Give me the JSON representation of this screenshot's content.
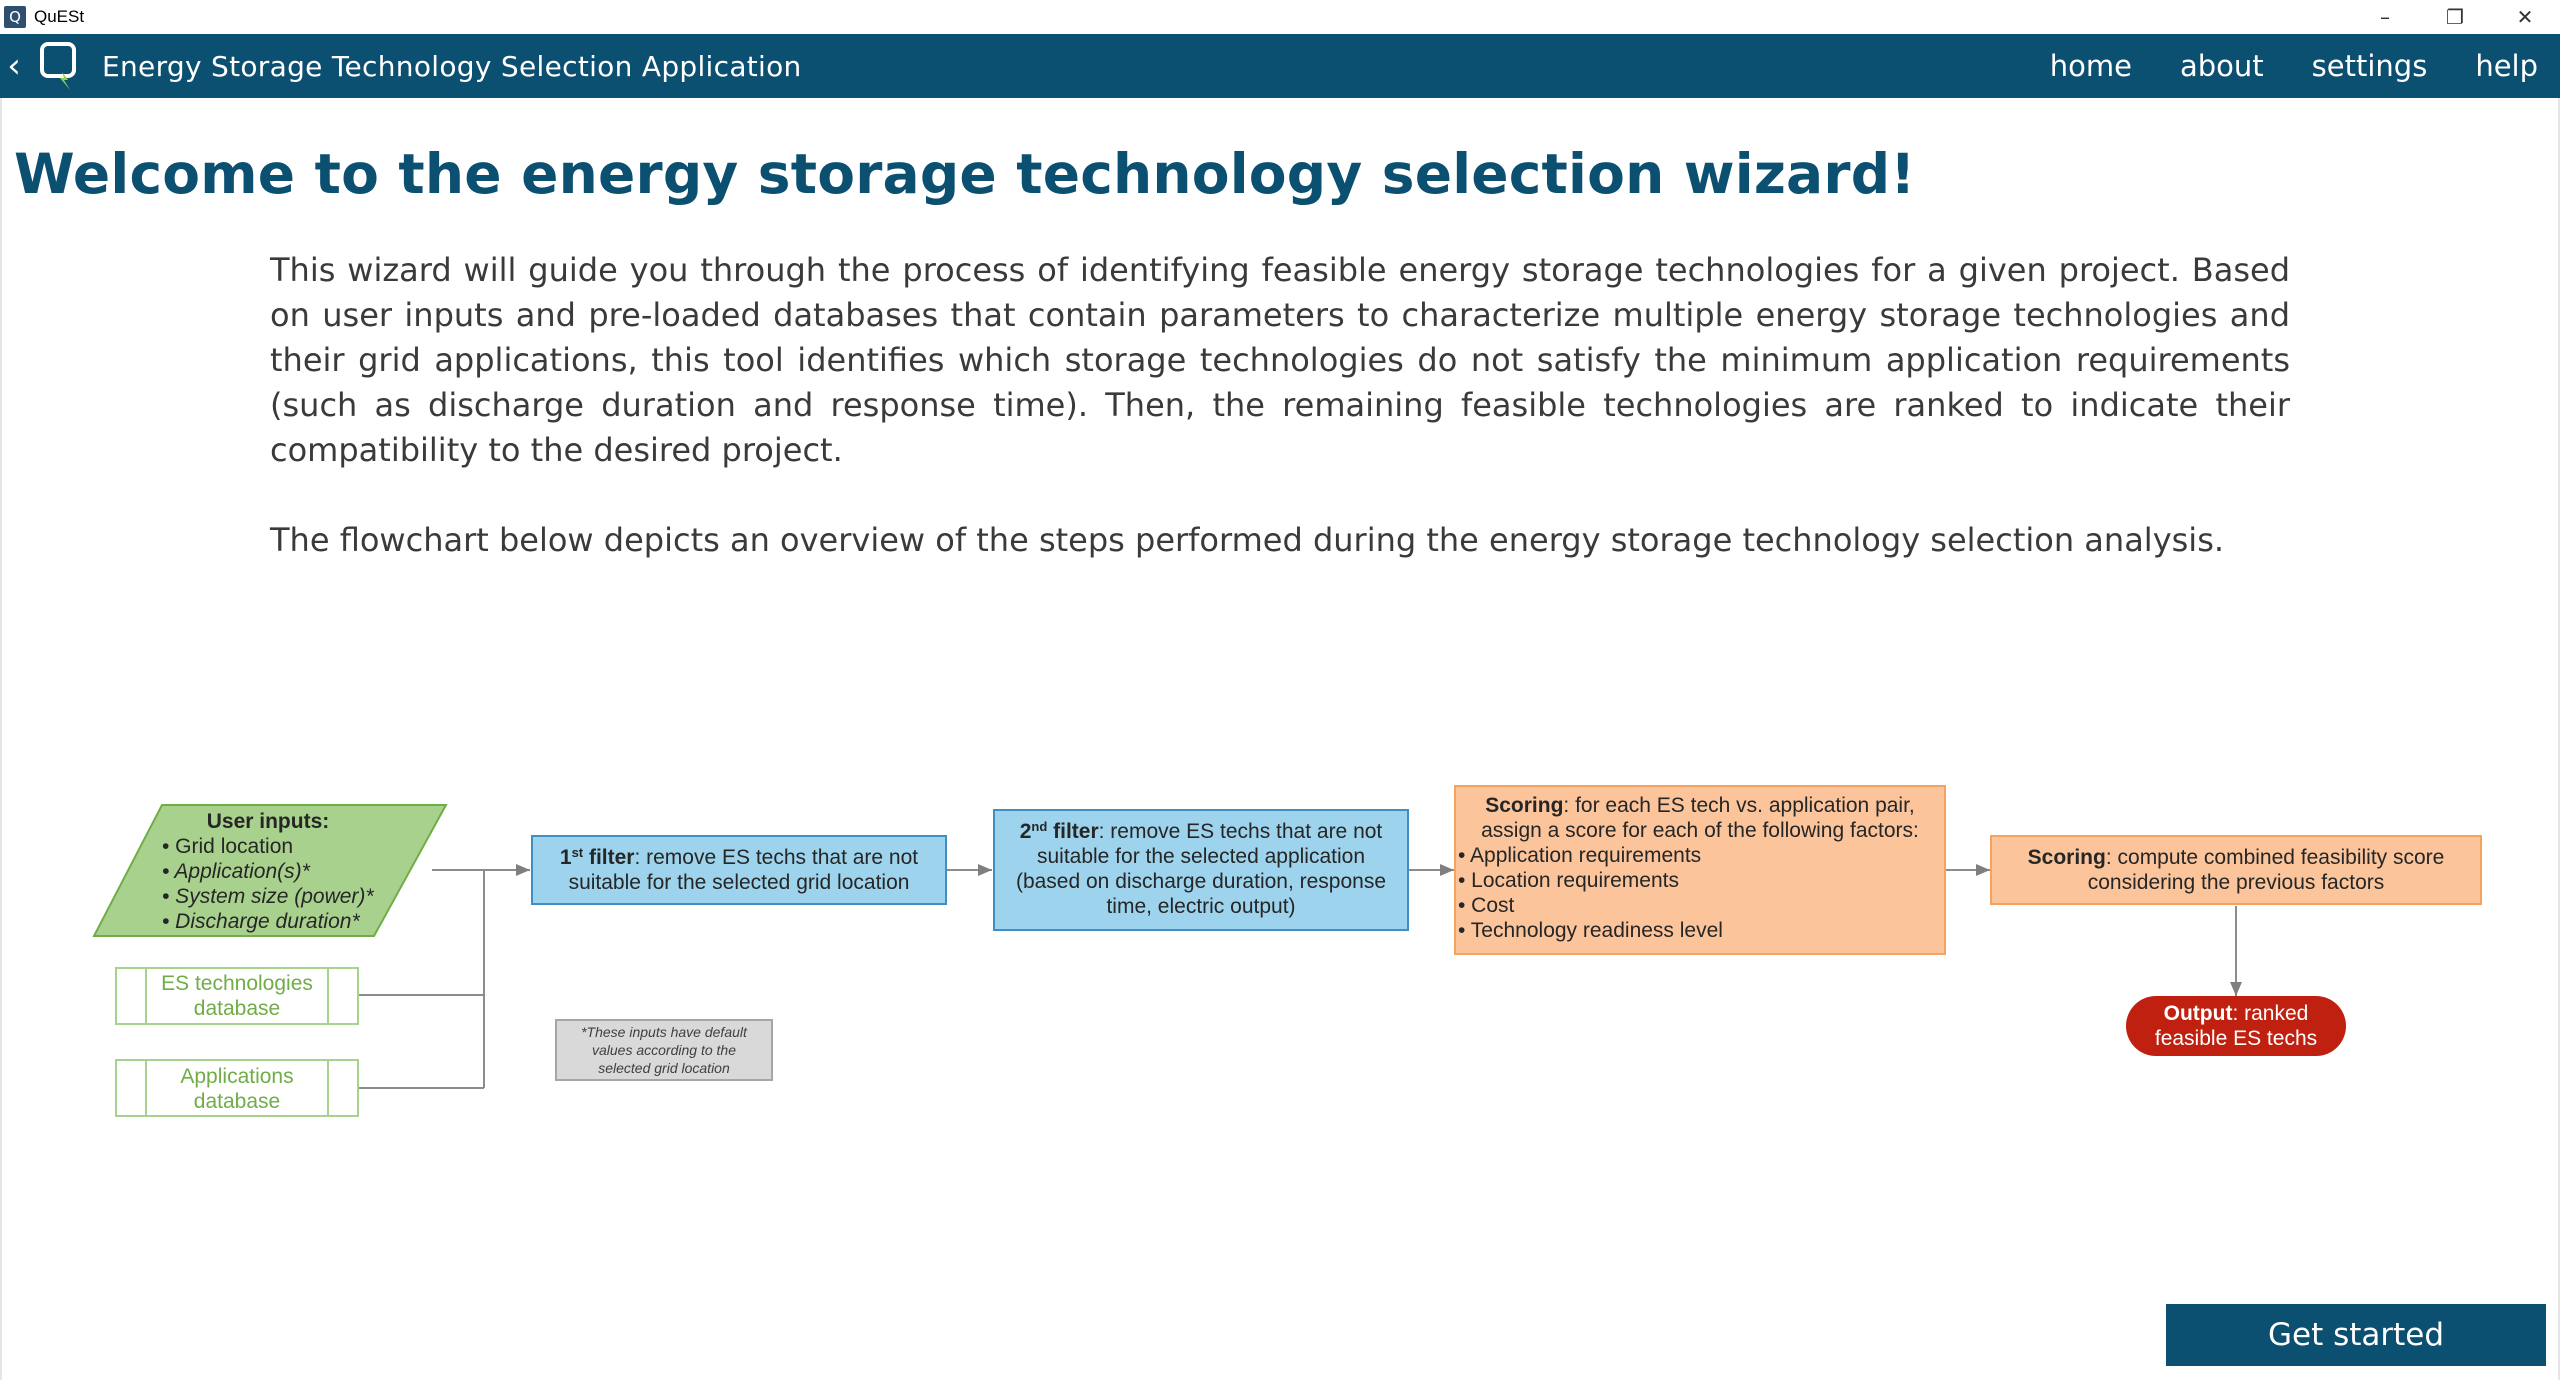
{
  "window": {
    "title": "QuESt",
    "icon_letter": "Q",
    "controls": [
      "minimize-icon",
      "restore-icon",
      "close-icon"
    ]
  },
  "appbar": {
    "title": "Energy Storage Technology Selection Application",
    "back_icon": "chevron-left-icon",
    "logo_icon": "quest-logo-icon",
    "nav": {
      "home": "home",
      "about": "about",
      "settings": "settings",
      "help": "help"
    }
  },
  "main": {
    "heading": "Welcome to the energy storage technology selection wizard!",
    "intro_paragraph": "This wizard will guide you through the process of identifying feasible energy storage technologies for a given project. Based on user inputs and pre-loaded databases that contain parameters to characterize multiple energy storage technologies and their grid applications, this tool identifies which storage technologies do not satisfy the minimum application requirements (such as discharge duration and response time). Then, the remaining feasible technologies are ranked to indicate their compatibility to the desired project.",
    "flowchart_intro": "The flowchart below depicts an overview of the steps performed during the energy storage technology selection analysis.",
    "get_started": "Get started"
  },
  "flowchart": {
    "user_inputs": {
      "title": "User inputs:",
      "items": [
        "• Grid location",
        "• Application(s)*",
        "• System size (power)*",
        "• Discharge duration*"
      ]
    },
    "es_db": [
      "ES technologies",
      "database"
    ],
    "app_db": [
      "Applications",
      "database"
    ],
    "note": [
      "*These inputs have default",
      "values according to the",
      "selected grid location"
    ],
    "filter1": {
      "label_num": "1",
      "label_sup": "st",
      "label_word": " filter",
      "line1": ": remove ES techs that are not",
      "line2": "suitable for the selected grid location"
    },
    "filter2": {
      "label_num": "2",
      "label_sup": "nd",
      "label_word": " filter",
      "line1": ": remove ES techs that are not",
      "line2": "suitable for the selected application",
      "line3": "(based on discharge duration, response",
      "line4": "time, electric output)"
    },
    "scoring1": {
      "label": "Scoring",
      "line1": ": for each ES tech vs. application pair,",
      "line2": "assign a score for each of the following factors:",
      "items": [
        "• Application requirements",
        "• Location requirements",
        "• Cost",
        "• Technology readiness level"
      ]
    },
    "scoring2": {
      "label": "Scoring",
      "line1": ": compute combined feasibility score",
      "line2": "considering the previous factors"
    },
    "output": {
      "label": "Output",
      "line1": ": ranked",
      "line2": "feasible ES techs"
    },
    "colors": {
      "input_fill": "#a9d18e",
      "input_stroke": "#70ad47",
      "db_text": "#70ad47",
      "filter_fill": "#9dd3ec",
      "filter_stroke": "#3f8fc4",
      "scoring_fill": "#fbc49b",
      "scoring_stroke": "#f4a460",
      "output_fill": "#c0200f",
      "note_fill": "#d9d9d9"
    }
  }
}
